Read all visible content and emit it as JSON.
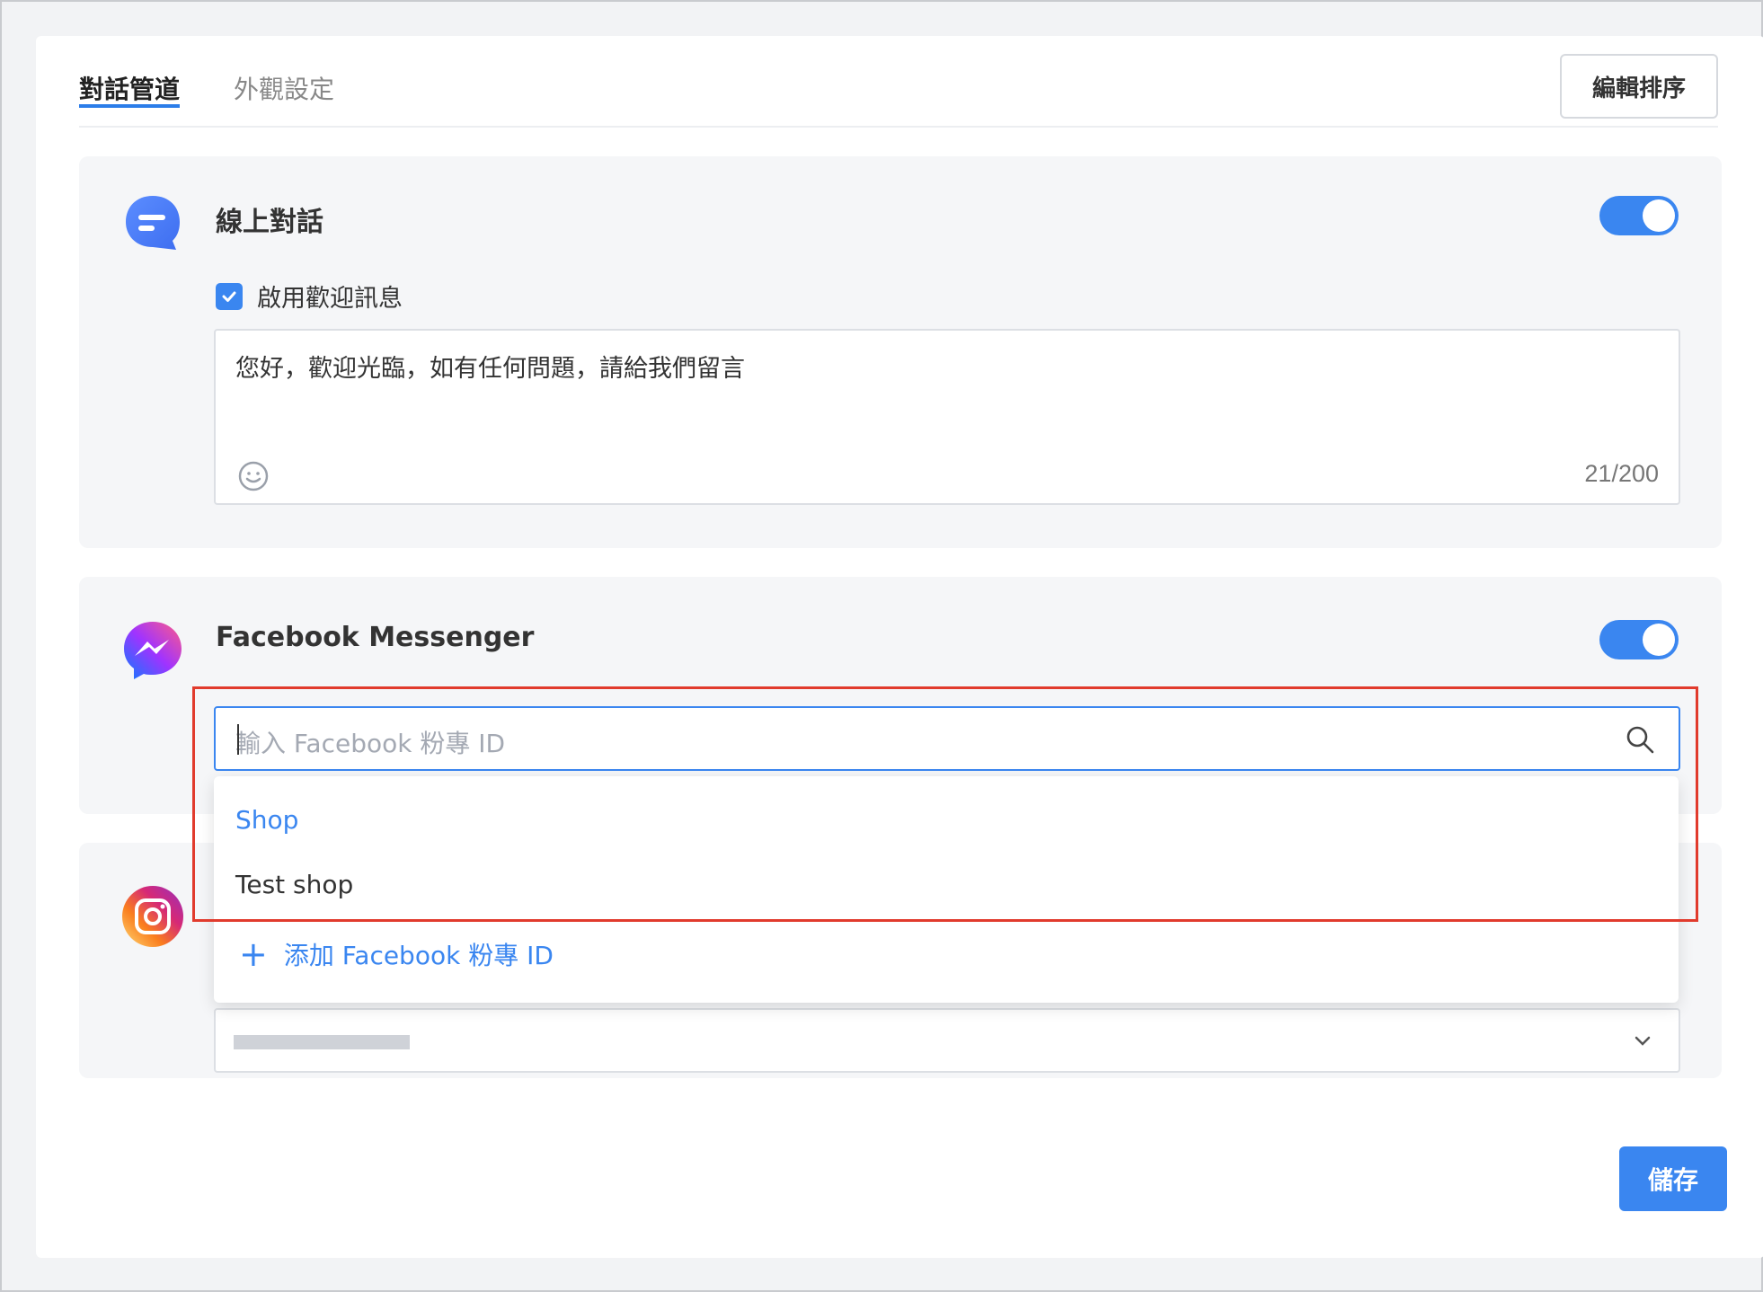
{
  "tabs": [
    {
      "label": "對話管道",
      "active": true
    },
    {
      "label": "外觀設定",
      "active": false
    }
  ],
  "header": {
    "edit_sort_label": "編輯排序"
  },
  "live_chat": {
    "title": "線上對話",
    "enabled": true,
    "welcome_checkbox_label": "啟用歡迎訊息",
    "welcome_checked": true,
    "welcome_text": "您好，歡迎光臨，如有任何問題，請給我們留言",
    "char_count": "21/200",
    "icon": "chat-bubble-icon"
  },
  "facebook": {
    "title": "Facebook Messenger",
    "enabled": true,
    "icon": "messenger-icon",
    "search_placeholder": "輸入 Facebook 粉專 ID",
    "dropdown_items": [
      "Shop",
      "Test shop"
    ],
    "selected_item": "Shop",
    "add_label": "添加 Facebook 粉專 ID"
  },
  "instagram": {
    "icon": "instagram-icon"
  },
  "footer": {
    "save_label": "儲存"
  },
  "colors": {
    "accent": "#3a86f0",
    "highlight": "#e13b2d",
    "panel_bg": "#f5f6f8"
  }
}
